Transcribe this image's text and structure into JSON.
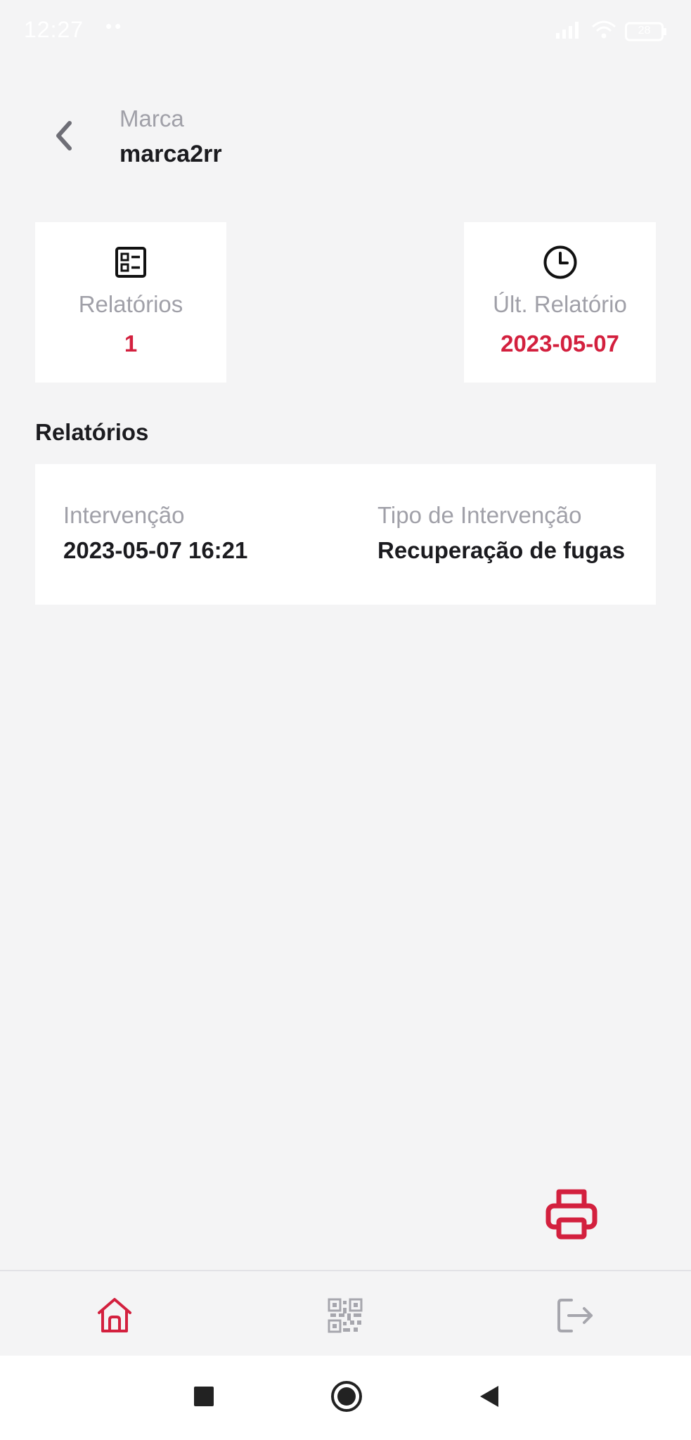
{
  "status_bar": {
    "time": "12:27",
    "dots": "••",
    "battery": "28"
  },
  "header": {
    "label": "Marca",
    "value": "marca2rr"
  },
  "stats": {
    "reports": {
      "icon": "report-list-icon",
      "label": "Relatórios",
      "value": "1"
    },
    "last_report": {
      "icon": "clock-icon",
      "label": "Últ. Relatório",
      "value": "2023-05-07"
    }
  },
  "section": {
    "title": "Relatórios"
  },
  "report": {
    "intervention_label": "Intervenção",
    "intervention_value": "2023-05-07 16:21",
    "type_label": "Tipo de Intervenção",
    "type_value": "Recuperação de fugas"
  },
  "actions": {
    "print_icon": "printer-icon"
  },
  "bottom_nav": {
    "items": [
      {
        "icon": "home-icon",
        "active": true
      },
      {
        "icon": "qr-code-icon",
        "active": false
      },
      {
        "icon": "logout-icon",
        "active": false
      }
    ]
  },
  "colors": {
    "accent": "#d3203e",
    "background": "#f4f4f5",
    "card": "#ffffff",
    "muted_text": "#a0a0a8",
    "text": "#1b1b1f"
  }
}
